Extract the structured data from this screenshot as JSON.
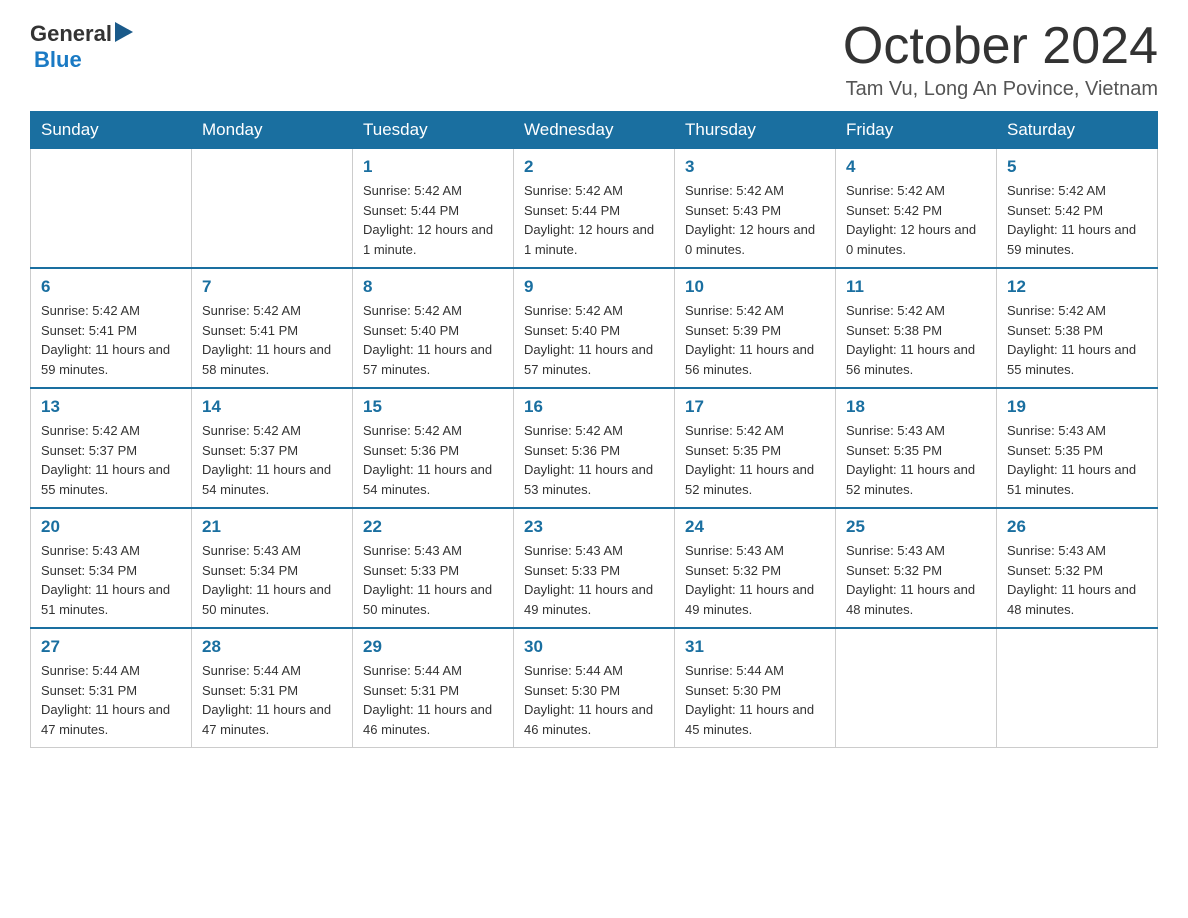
{
  "header": {
    "logo_general": "General",
    "logo_blue": "Blue",
    "month_title": "October 2024",
    "location": "Tam Vu, Long An Povince, Vietnam"
  },
  "days_of_week": [
    "Sunday",
    "Monday",
    "Tuesday",
    "Wednesday",
    "Thursday",
    "Friday",
    "Saturday"
  ],
  "weeks": [
    [
      {
        "day": "",
        "info": ""
      },
      {
        "day": "",
        "info": ""
      },
      {
        "day": "1",
        "info": "Sunrise: 5:42 AM\nSunset: 5:44 PM\nDaylight: 12 hours and 1 minute."
      },
      {
        "day": "2",
        "info": "Sunrise: 5:42 AM\nSunset: 5:44 PM\nDaylight: 12 hours and 1 minute."
      },
      {
        "day": "3",
        "info": "Sunrise: 5:42 AM\nSunset: 5:43 PM\nDaylight: 12 hours and 0 minutes."
      },
      {
        "day": "4",
        "info": "Sunrise: 5:42 AM\nSunset: 5:42 PM\nDaylight: 12 hours and 0 minutes."
      },
      {
        "day": "5",
        "info": "Sunrise: 5:42 AM\nSunset: 5:42 PM\nDaylight: 11 hours and 59 minutes."
      }
    ],
    [
      {
        "day": "6",
        "info": "Sunrise: 5:42 AM\nSunset: 5:41 PM\nDaylight: 11 hours and 59 minutes."
      },
      {
        "day": "7",
        "info": "Sunrise: 5:42 AM\nSunset: 5:41 PM\nDaylight: 11 hours and 58 minutes."
      },
      {
        "day": "8",
        "info": "Sunrise: 5:42 AM\nSunset: 5:40 PM\nDaylight: 11 hours and 57 minutes."
      },
      {
        "day": "9",
        "info": "Sunrise: 5:42 AM\nSunset: 5:40 PM\nDaylight: 11 hours and 57 minutes."
      },
      {
        "day": "10",
        "info": "Sunrise: 5:42 AM\nSunset: 5:39 PM\nDaylight: 11 hours and 56 minutes."
      },
      {
        "day": "11",
        "info": "Sunrise: 5:42 AM\nSunset: 5:38 PM\nDaylight: 11 hours and 56 minutes."
      },
      {
        "day": "12",
        "info": "Sunrise: 5:42 AM\nSunset: 5:38 PM\nDaylight: 11 hours and 55 minutes."
      }
    ],
    [
      {
        "day": "13",
        "info": "Sunrise: 5:42 AM\nSunset: 5:37 PM\nDaylight: 11 hours and 55 minutes."
      },
      {
        "day": "14",
        "info": "Sunrise: 5:42 AM\nSunset: 5:37 PM\nDaylight: 11 hours and 54 minutes."
      },
      {
        "day": "15",
        "info": "Sunrise: 5:42 AM\nSunset: 5:36 PM\nDaylight: 11 hours and 54 minutes."
      },
      {
        "day": "16",
        "info": "Sunrise: 5:42 AM\nSunset: 5:36 PM\nDaylight: 11 hours and 53 minutes."
      },
      {
        "day": "17",
        "info": "Sunrise: 5:42 AM\nSunset: 5:35 PM\nDaylight: 11 hours and 52 minutes."
      },
      {
        "day": "18",
        "info": "Sunrise: 5:43 AM\nSunset: 5:35 PM\nDaylight: 11 hours and 52 minutes."
      },
      {
        "day": "19",
        "info": "Sunrise: 5:43 AM\nSunset: 5:35 PM\nDaylight: 11 hours and 51 minutes."
      }
    ],
    [
      {
        "day": "20",
        "info": "Sunrise: 5:43 AM\nSunset: 5:34 PM\nDaylight: 11 hours and 51 minutes."
      },
      {
        "day": "21",
        "info": "Sunrise: 5:43 AM\nSunset: 5:34 PM\nDaylight: 11 hours and 50 minutes."
      },
      {
        "day": "22",
        "info": "Sunrise: 5:43 AM\nSunset: 5:33 PM\nDaylight: 11 hours and 50 minutes."
      },
      {
        "day": "23",
        "info": "Sunrise: 5:43 AM\nSunset: 5:33 PM\nDaylight: 11 hours and 49 minutes."
      },
      {
        "day": "24",
        "info": "Sunrise: 5:43 AM\nSunset: 5:32 PM\nDaylight: 11 hours and 49 minutes."
      },
      {
        "day": "25",
        "info": "Sunrise: 5:43 AM\nSunset: 5:32 PM\nDaylight: 11 hours and 48 minutes."
      },
      {
        "day": "26",
        "info": "Sunrise: 5:43 AM\nSunset: 5:32 PM\nDaylight: 11 hours and 48 minutes."
      }
    ],
    [
      {
        "day": "27",
        "info": "Sunrise: 5:44 AM\nSunset: 5:31 PM\nDaylight: 11 hours and 47 minutes."
      },
      {
        "day": "28",
        "info": "Sunrise: 5:44 AM\nSunset: 5:31 PM\nDaylight: 11 hours and 47 minutes."
      },
      {
        "day": "29",
        "info": "Sunrise: 5:44 AM\nSunset: 5:31 PM\nDaylight: 11 hours and 46 minutes."
      },
      {
        "day": "30",
        "info": "Sunrise: 5:44 AM\nSunset: 5:30 PM\nDaylight: 11 hours and 46 minutes."
      },
      {
        "day": "31",
        "info": "Sunrise: 5:44 AM\nSunset: 5:30 PM\nDaylight: 11 hours and 45 minutes."
      },
      {
        "day": "",
        "info": ""
      },
      {
        "day": "",
        "info": ""
      }
    ]
  ]
}
